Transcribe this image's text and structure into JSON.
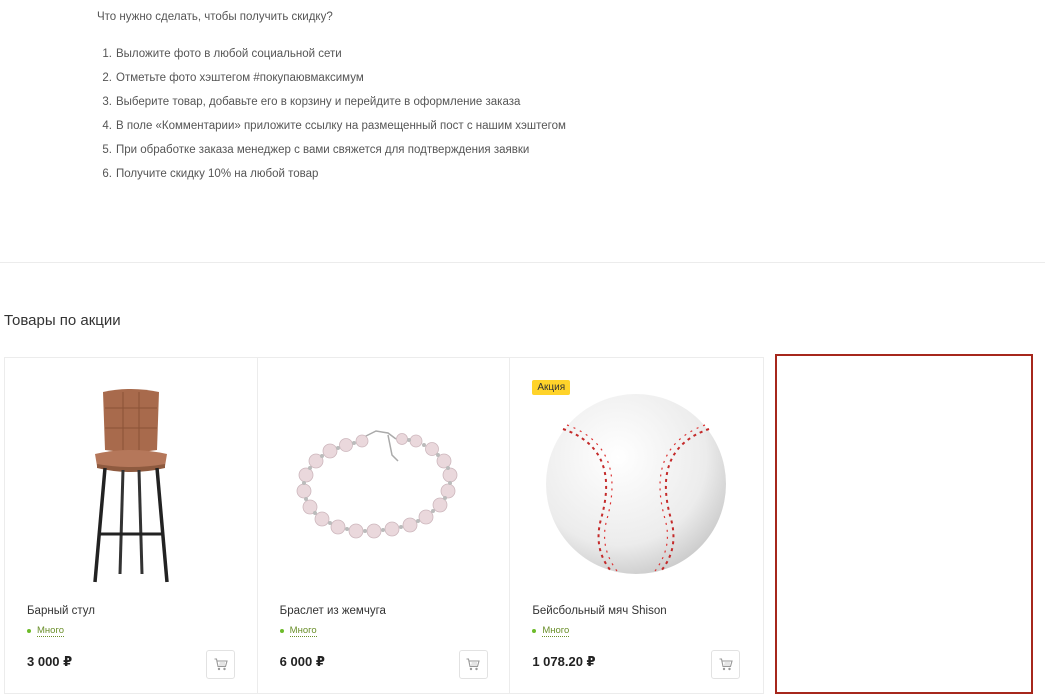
{
  "intro": {
    "question": "Что нужно сделать, чтобы получить скидку?",
    "steps": [
      {
        "num": "1.",
        "text": "Выложите фото в любой социальной сети"
      },
      {
        "num": "2.",
        "text": "Отметьте фото хэштегом #покупаювмаксимум"
      },
      {
        "num": "3.",
        "text": "Выберите товар, добавьте его в корзину и перейдите в оформление заказа"
      },
      {
        "num": "4.",
        "text": "В поле «Комментарии» приложите ссылку на размещенный пост с нашим хэштегом"
      },
      {
        "num": "5.",
        "text": "При обработке заказа менеджер с вами свяжется для подтверждения заявки"
      },
      {
        "num": "6.",
        "text": "Получите скидку 10% на любой товар"
      }
    ]
  },
  "section": {
    "title": "Товары по акции"
  },
  "products": [
    {
      "name": "Барный стул",
      "stock": "Много",
      "price": "3 000 ₽",
      "badge": ""
    },
    {
      "name": "Браслет из жемчуга",
      "stock": "Много",
      "price": "6 000 ₽",
      "badge": ""
    },
    {
      "name": "Бейсбольный мяч Shison",
      "stock": "Много",
      "price": "1 078.20 ₽",
      "badge": "Акция"
    }
  ],
  "colors": {
    "badge_bg": "#ffd32a",
    "stock_green": "#6dbb2a",
    "highlight_border": "#a6271c"
  },
  "icons": [
    "cart-icon"
  ]
}
